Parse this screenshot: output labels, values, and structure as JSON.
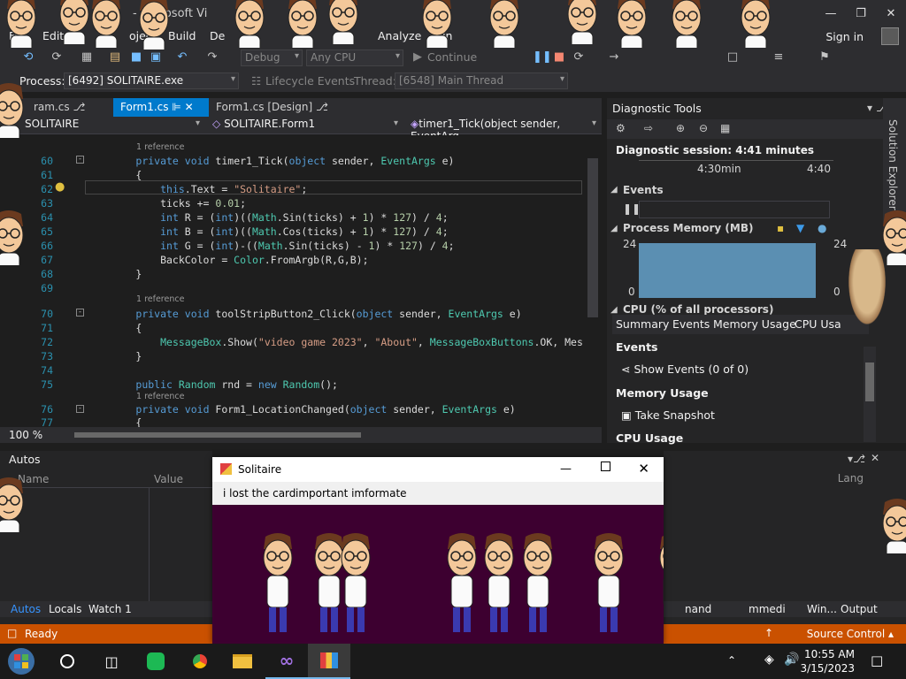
{
  "titlebar": {
    "title": "- Microsoft Vi"
  },
  "menu": {
    "items": [
      "File",
      "Edit",
      "oject",
      "Build",
      "De",
      "Analyze",
      "Win",
      "p"
    ],
    "signin": "Sign in"
  },
  "toolbar": {
    "config": "Debug",
    "platform": "Any CPU",
    "continue": "Continue"
  },
  "procbar": {
    "process_label": "Process:",
    "process_value": "[6492] SOLITAIRE.exe",
    "lifecycle": "Lifecycle Events",
    "thread_label": "Thread:",
    "thread_value": "[6548] Main Thread"
  },
  "editor": {
    "tabs": [
      "ram.cs",
      "Form1.cs",
      "Form1.cs [Design]"
    ],
    "nav": [
      "SOLITAIRE",
      "SOLITAIRE.Form1",
      "timer1_Tick(object sender, EventArg"
    ],
    "zoom": "100 %",
    "refs": [
      "1 reference",
      "1 reference",
      "1 reference"
    ],
    "lines": [
      {
        "n": "60",
        "t": "        private void timer1_Tick(object sender, EventArgs e)"
      },
      {
        "n": "61",
        "t": "        {"
      },
      {
        "n": "62",
        "t": "            this.Text = \"Solitaire\";"
      },
      {
        "n": "63",
        "t": "            ticks += 0.01;"
      },
      {
        "n": "64",
        "t": "            int R = (int)((Math.Sin(ticks) + 1) * 127) / 4;"
      },
      {
        "n": "65",
        "t": "            int B = (int)((Math.Cos(ticks) + 1) * 127) / 4;"
      },
      {
        "n": "66",
        "t": "            int G = (int)-((Math.Sin(ticks) - 1) * 127) / 4;"
      },
      {
        "n": "67",
        "t": "            BackColor = Color.FromArgb(R,G,B);"
      },
      {
        "n": "68",
        "t": "        }"
      },
      {
        "n": "69",
        "t": ""
      },
      {
        "n": "70",
        "t": "        private void toolStripButton2_Click(object sender, EventArgs e)"
      },
      {
        "n": "71",
        "t": "        {"
      },
      {
        "n": "72",
        "t": "            MessageBox.Show(\"video game 2023\", \"About\", MessageBoxButtons.OK, Mes"
      },
      {
        "n": "73",
        "t": "        }"
      },
      {
        "n": "74",
        "t": ""
      },
      {
        "n": "75",
        "t": "        public Random rnd = new Random();"
      },
      {
        "n": "76",
        "t": "        private void Form1_LocationChanged(object sender, EventArgs e)"
      },
      {
        "n": "77",
        "t": "        {"
      }
    ]
  },
  "diag": {
    "title": "Diagnostic Tools",
    "session": "Diagnostic session: 4:41 minutes",
    "time1": "4:30min",
    "time2": "4:40",
    "events": "Events",
    "memory": "Process Memory (MB)",
    "mem_max": "24",
    "mem_min": "0",
    "cpu": "CPU (% of all processors)",
    "subtabs": [
      "Summary",
      "Events",
      "Memory Usage",
      "CPU Usa"
    ],
    "events_h": "Events",
    "show_events": "Show Events (0 of 0)",
    "memory_h": "Memory Usage",
    "snapshot": "Take Snapshot",
    "cpu_h": "CPU Usage"
  },
  "autos": {
    "title": "Autos",
    "col_name": "Name",
    "col_value": "Value",
    "col_lang": "Lang",
    "tabs": [
      "Autos",
      "Locals",
      "Watch 1"
    ],
    "right_tabs": [
      "nand",
      "mmedi",
      "Win...",
      "Output"
    ]
  },
  "status": {
    "ready": "Ready",
    "source": "Source Control"
  },
  "solitaire": {
    "title": "Solitaire",
    "menu": [
      "i lost the card",
      "important imformate"
    ]
  },
  "taskbar": {
    "time": "10:55 AM",
    "date": "3/15/2023"
  },
  "colors": {
    "accent": "#007acc",
    "status": "#ca5100",
    "sol_bg": "#3d0030"
  }
}
